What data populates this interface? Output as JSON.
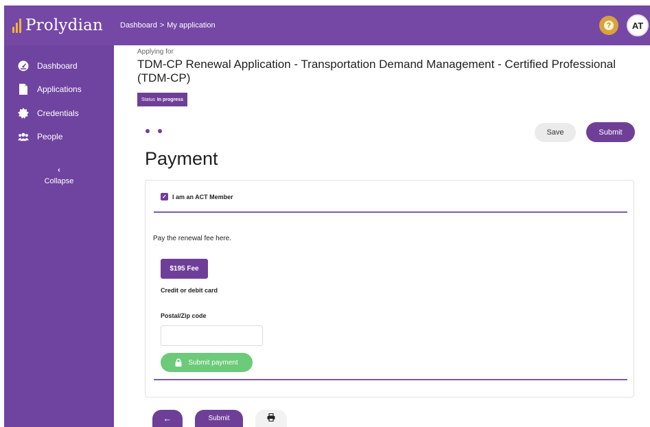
{
  "header": {
    "logo_text": "Prolydian",
    "breadcrumb": [
      "Dashboard",
      "My application"
    ],
    "breadcrumb_separator": ">",
    "help_icon": "question-icon",
    "avatar_initials": "AT",
    "colors": {
      "brand": "#7548a6",
      "logo_accent": "#f1b43b",
      "help": "#d9a23a"
    }
  },
  "sidebar": {
    "items": [
      {
        "label": "Dashboard",
        "icon": "dashboard-gauge-icon"
      },
      {
        "label": "Applications",
        "icon": "document-icon"
      },
      {
        "label": "Credentials",
        "icon": "certificate-seal-icon"
      },
      {
        "label": "People",
        "icon": "people-icon"
      }
    ],
    "collapse_label": "Collapse",
    "collapse_icon": "chevron-left-icon"
  },
  "application": {
    "applying_for": "Applying for",
    "title": "TDM-CP Renewal Application - Transportation Demand Management - Certified Professional (TDM-CP)",
    "status_label": "Status",
    "status_value": "In progress"
  },
  "actions": {
    "save": "Save",
    "submit": "Submit"
  },
  "steps": {
    "count": 2
  },
  "page": {
    "title": "Payment",
    "member_checkbox_label": "I am an ACT Member",
    "member_checked": true,
    "instruction": "Pay the renewal fee here.",
    "fee_button": "$195 Fee",
    "card_label": "Credit or debit card",
    "postal_label": "Postal/Zip code",
    "postal_value": "",
    "submit_payment": "Submit payment"
  },
  "bottom_bar": {
    "back_icon": "arrow-left-icon",
    "submit": "Submit",
    "print_icon": "print-icon"
  }
}
